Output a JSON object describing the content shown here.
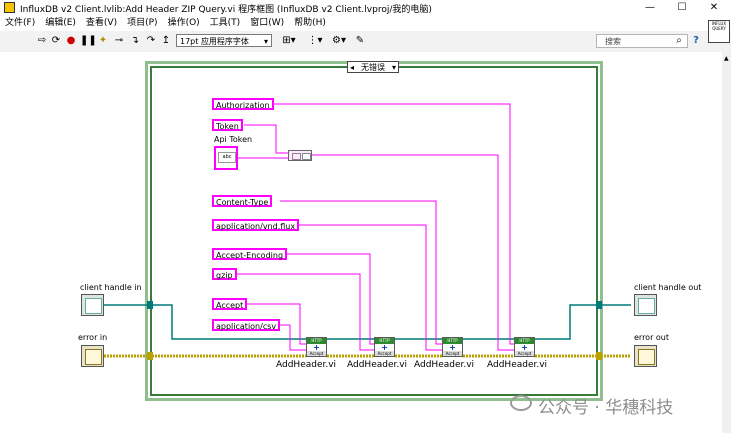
{
  "window": {
    "title": "InfluxDB v2 Client.lvlib:Add Header ZIP Query.vi 程序框图  (InfluxDB v2 Client.lvproj/我的电脑)",
    "minimize": "—",
    "maximize": "☐",
    "close": "✕"
  },
  "menu": [
    "文件(F)",
    "编辑(E)",
    "查看(V)",
    "项目(P)",
    "操作(O)",
    "工具(T)",
    "窗口(W)",
    "帮助(H)"
  ],
  "toolbar": {
    "font": "17pt 应用程序字体",
    "search_placeholder": "搜索",
    "search_icon": "magnifier",
    "help_icon": "?"
  },
  "vi_icon_text": "INFLUX QUERY",
  "case_selector": "无错误",
  "constants": {
    "authorization": "Authorization",
    "token": "Token",
    "content_type": "Content-Type",
    "content_type_value": "application/vnd.flux",
    "accept_encoding": "Accept-Encoding",
    "gzip": "gzip",
    "accept": "Accept",
    "accept_value": "application/csv"
  },
  "controls": {
    "api_token_label": "Api Token",
    "client_handle_in": "client handle in",
    "client_handle_out": "client handle out",
    "error_in": "error in",
    "error_out": "error out"
  },
  "subvis": [
    "AddHeader.vi",
    "AddHeader.vi",
    "AddHeader.vi",
    "AddHeader.vi"
  ],
  "watermark": "公众号 · 华穗科技",
  "colors": {
    "string_wire": "#ff00ff",
    "refnum_wire": "#007a7a",
    "error_wire": "#b8a200",
    "structure_border": "#3a7a3a"
  }
}
